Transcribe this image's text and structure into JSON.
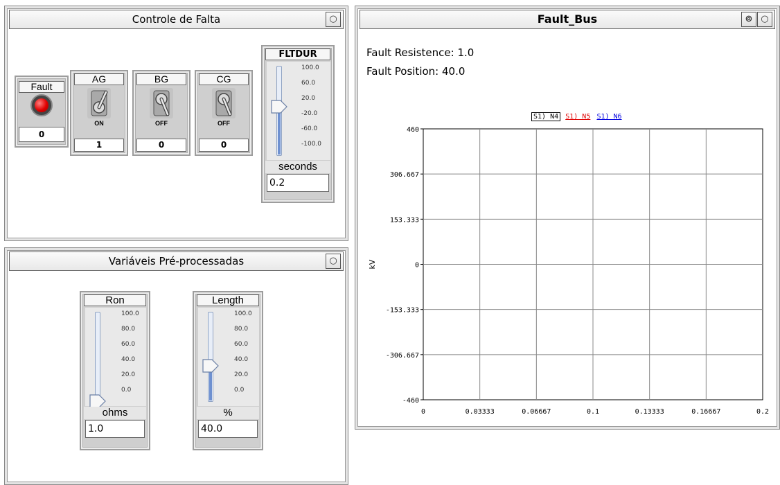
{
  "fault_control_panel": {
    "title": "Controle de Falta",
    "fault_button": {
      "label": "Fault",
      "value": "0"
    },
    "switches": [
      {
        "label": "AG",
        "state": "ON",
        "value": "1"
      },
      {
        "label": "BG",
        "state": "OFF",
        "value": "0"
      },
      {
        "label": "CG",
        "state": "OFF",
        "value": "0"
      }
    ],
    "fltdur": {
      "label": "FLTDUR",
      "ticks": [
        "100.0",
        "60.0",
        "20.0",
        "-20.0",
        "-60.0",
        "-100.0"
      ],
      "unit": "seconds",
      "value": "0.2",
      "level": 0.55
    }
  },
  "preprocessed_panel": {
    "title": "Variáveis Pré-processadas",
    "ron": {
      "label": "Ron",
      "ticks": [
        "100.0",
        "80.0",
        "60.0",
        "40.0",
        "20.0",
        "0.0"
      ],
      "unit": "ohms",
      "value": "1.0",
      "level": 0.01
    },
    "length": {
      "label": "Length",
      "ticks": [
        "100.0",
        "80.0",
        "60.0",
        "40.0",
        "20.0",
        "0.0"
      ],
      "unit": "%",
      "value": "40.0",
      "level": 0.4
    }
  },
  "fault_bus_panel": {
    "title": "Fault_Bus",
    "fault_resistence": "Fault Resistence: 1.0",
    "fault_position": "Fault Position: 40.0",
    "legend": [
      {
        "label": "S1) N4",
        "color": "#000000"
      },
      {
        "label": "S1) N5",
        "color": "#e00000"
      },
      {
        "label": "S1) N6",
        "color": "#0000e0"
      }
    ]
  },
  "chart_data": {
    "type": "line",
    "ylabel": "kV",
    "xlabel": "",
    "ylim": [
      -460,
      460
    ],
    "xlim": [
      0,
      0.2
    ],
    "y_ticks": [
      "460",
      "306.667",
      "153.333",
      "0",
      "-153.333",
      "-306.667",
      "-460"
    ],
    "x_ticks": [
      "0",
      "0.03333",
      "0.06667",
      "0.1",
      "0.13333",
      "0.16667",
      "0.2"
    ],
    "grid": true,
    "legend_position": "top",
    "series": [
      {
        "name": "S1) N4",
        "values": []
      },
      {
        "name": "S1) N5",
        "values": []
      },
      {
        "name": "S1) N6",
        "values": []
      }
    ]
  }
}
